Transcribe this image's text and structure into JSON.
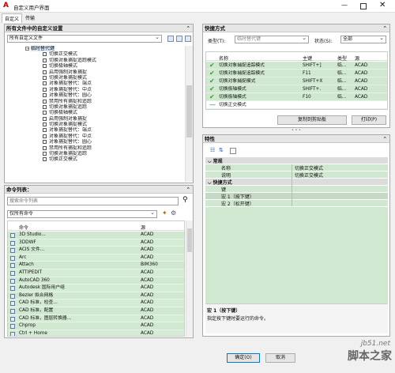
{
  "window": {
    "title": "自定义用户界面",
    "tabs": [
      "自定义",
      "传输"
    ]
  },
  "left_top": {
    "header": "所有文件中的自定义设置",
    "dropdown": "所有自定义文件",
    "root": "临时替代键",
    "items": [
      "切换正交模式",
      "切换对象捕捉追踪模式",
      "切换极轴模式",
      "启用强制对象捕捉",
      "切换对象捕捉模式",
      "对象捕捉替代：端点",
      "对象捕捉替代：中点",
      "对象捕捉替代：圆心",
      "禁用所有捕捉和追踪",
      "切换对象捕捉追踪",
      "切换极轴模式",
      "启用强制对象捕捉",
      "切换对象捕捉模式",
      "对象捕捉替代：端点",
      "对象捕捉替代：中点",
      "对象捕捉替代：圆心",
      "禁用所有捕捉和追踪",
      "切换对象捕捉追踪",
      "切换正交模式"
    ]
  },
  "commands": {
    "header": "命令列表：",
    "search_placeholder": "搜索命令列表",
    "filter": "仅所有命令",
    "col_command": "命令",
    "col_source": "源",
    "rows": [
      [
        "3D Studio...",
        "ACAD"
      ],
      [
        "3DDWF",
        "ACAD"
      ],
      [
        "ACIS 文件...",
        "ACAD"
      ],
      [
        "Arc",
        "ACAD"
      ],
      [
        "Attach",
        "BIM360"
      ],
      [
        "ATTIPEDIT",
        "ACAD"
      ],
      [
        "AutoCAD 360",
        "ACAD"
      ],
      [
        "Autodesk 国际用户组",
        "ACAD"
      ],
      [
        "Bezier 拟合网格",
        "ACAD"
      ],
      [
        "CAD 标准，检查...",
        "ACAD"
      ],
      [
        "CAD 标准，配置",
        "ACAD"
      ],
      [
        "CAD 标准，图层转换器...",
        "ACAD"
      ],
      [
        "Chprop",
        "ACAD"
      ],
      [
        "Ctrl + Home",
        "ACAD"
      ]
    ]
  },
  "shortcuts": {
    "header": "快捷方式",
    "type_label": "类型(T):",
    "type_value": "临时替代键",
    "status_label": "状态(S):",
    "status_value": "全部",
    "cols": [
      "名称",
      "主键",
      "类型",
      "源"
    ],
    "rows": [
      [
        "切换对象捕捉追踪模式",
        "SHIFT+]",
        "临...",
        "ACAD"
      ],
      [
        "切换对象捕捉追踪模式",
        "F11",
        "临...",
        "ACAD"
      ],
      [
        "切换对象捕捉模式",
        "SHIFT+X",
        "临...",
        "ACAD"
      ],
      [
        "切换极轴模式",
        "SHIFT+.",
        "临...",
        "ACAD"
      ],
      [
        "切换极轴模式",
        "F10",
        "临...",
        "ACAD"
      ],
      [
        "切换正交模式",
        "",
        "",
        ""
      ]
    ],
    "copy_btn": "复制到剪贴板",
    "print_btn": "打印(P)"
  },
  "props": {
    "header": "特性",
    "sec_general": "常规",
    "name_k": "名称",
    "name_v": "切换正交模式",
    "desc_k": "说明",
    "desc_v": "切换正交模式",
    "sec_keys": "快捷方式",
    "keys_k": "键",
    "macro1_k": "宏 1（按下键）",
    "macro2_k": "宏 2（松开键）",
    "help_title": "宏 1（按下键）",
    "help_text": "指定按下键时要运行的命令。"
  },
  "buttons": {
    "ok": "确定(O)",
    "cancel": "取消"
  },
  "watermark": {
    "site": "jb51.net",
    "brand": "脚本之家"
  }
}
